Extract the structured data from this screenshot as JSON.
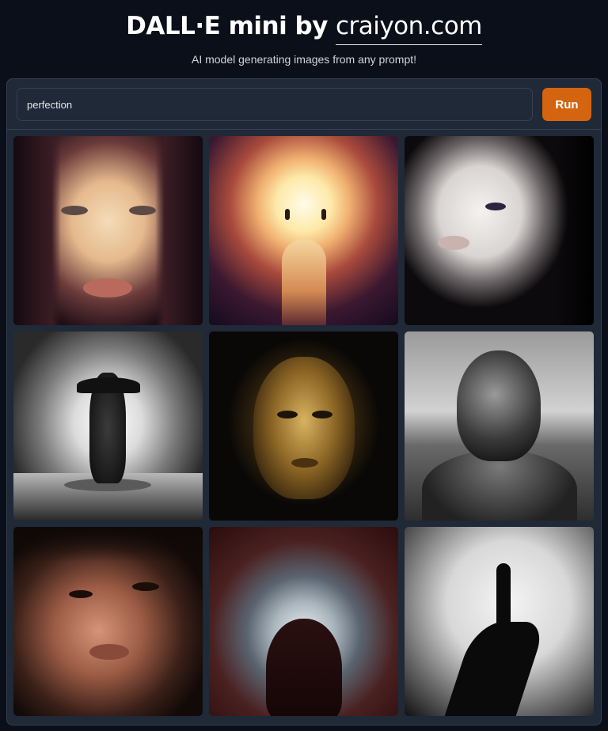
{
  "header": {
    "title_main": "DALL·E mini by",
    "title_link": "craiyon.com",
    "subtitle": "AI model generating images from any prompt!"
  },
  "search": {
    "value": "perfection",
    "run_label": "Run"
  },
  "images": [
    {
      "icon": "image-face-warm"
    },
    {
      "icon": "image-glowing-sun"
    },
    {
      "icon": "image-pale-face"
    },
    {
      "icon": "image-sparkling-statue"
    },
    {
      "icon": "image-golden-mask"
    },
    {
      "icon": "image-granite-head"
    },
    {
      "icon": "image-woman-face"
    },
    {
      "icon": "image-halo-silhouette"
    },
    {
      "icon": "image-shadow-hand"
    }
  ],
  "colors": {
    "background": "#0b0f19",
    "panel": "#1f2937",
    "border": "#374151",
    "accent": "#d56410"
  }
}
